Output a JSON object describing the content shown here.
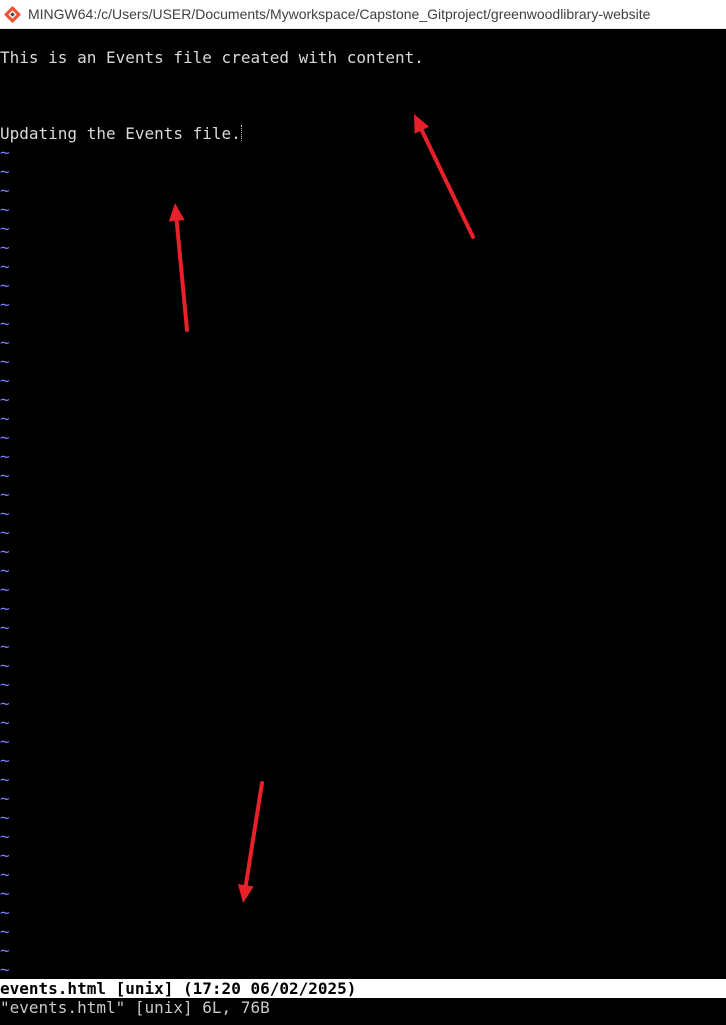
{
  "window": {
    "title": "MINGW64:/c/Users/USER/Documents/Myworkspace/Capstone_Gitproject/greenwoodlibrary-website",
    "icon": "git-bash-icon"
  },
  "editor": {
    "lines": [
      "This is an Events file created with content.",
      "",
      "",
      "Updating the Events file."
    ],
    "empty_line_marker": "~",
    "empty_line_marker_color": "#7f7fff",
    "text_color": "#d9d9d9"
  },
  "status": {
    "file_info": "events.html [unix] (17:20 06/02/2025)",
    "message": "\"events.html\" [unix] 6L, 76B"
  },
  "annotations": {
    "arrow_color": "#e8202a"
  }
}
